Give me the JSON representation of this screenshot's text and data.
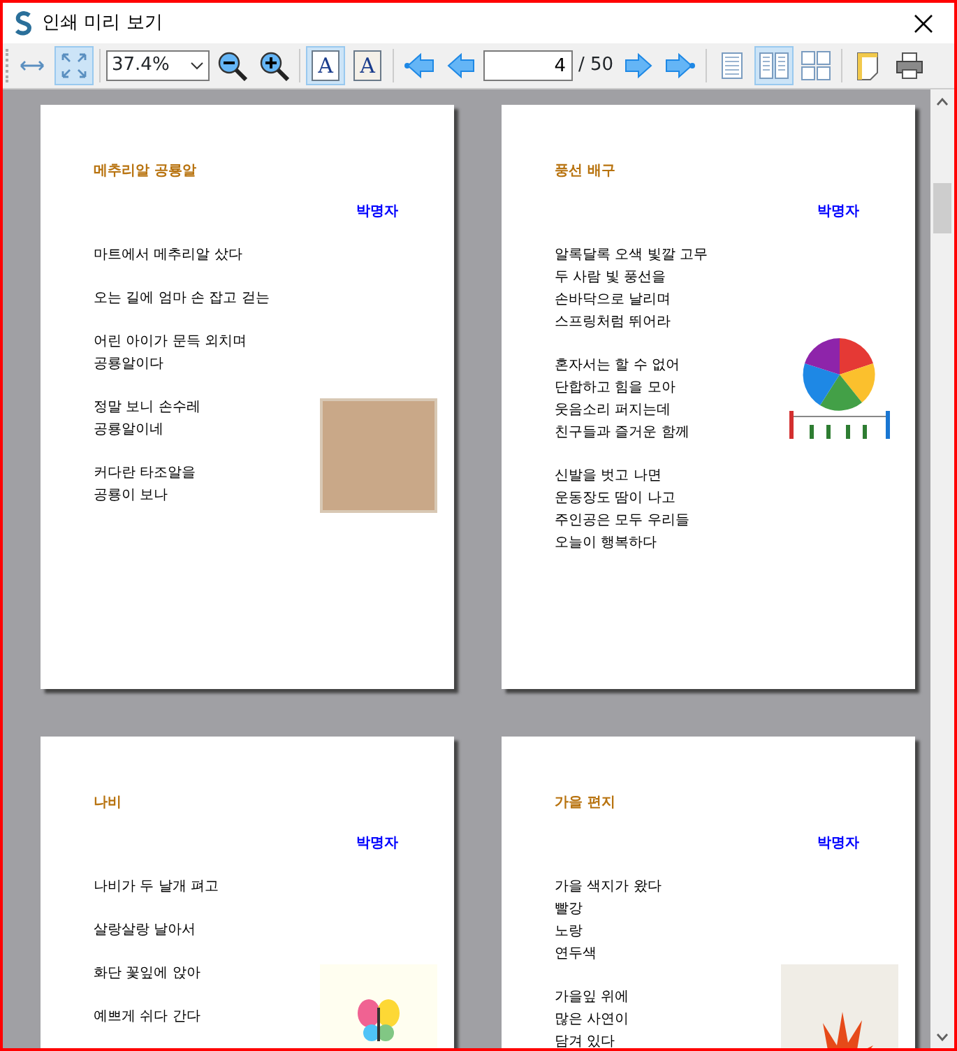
{
  "window": {
    "title": "인쇄 미리 보기"
  },
  "toolbar": [
    {
      "kind": "fit-width",
      "selected": false
    },
    {
      "kind": "fit-page",
      "selected": true
    },
    {
      "kind": "separator"
    },
    {
      "kind": "zoom-select",
      "value": "37.4%"
    },
    {
      "kind": "zoom-out"
    },
    {
      "kind": "zoom-in"
    },
    {
      "kind": "separator"
    },
    {
      "kind": "text-mode",
      "label": "A",
      "selected": true
    },
    {
      "kind": "page-text-mode",
      "label": "A",
      "selected": false
    },
    {
      "kind": "separator"
    },
    {
      "kind": "first-page"
    },
    {
      "kind": "prev-page"
    },
    {
      "kind": "page-input",
      "value": "4"
    },
    {
      "kind": "page-total",
      "text": "/ 50"
    },
    {
      "kind": "next-page"
    },
    {
      "kind": "last-page"
    },
    {
      "kind": "separator"
    },
    {
      "kind": "layout-single",
      "selected": false
    },
    {
      "kind": "layout-double",
      "selected": true
    },
    {
      "kind": "layout-quad",
      "selected": false
    },
    {
      "kind": "separator"
    },
    {
      "kind": "page-setup"
    },
    {
      "kind": "print"
    }
  ],
  "pages": [
    {
      "title": "메추리알 공룡알",
      "author": "박명자",
      "picture": {
        "kind": "photo"
      },
      "stanzas": [
        [
          "마트에서 메추리알 샀다"
        ],
        [
          "오는 길에 엄마 손 잡고 걷는"
        ],
        [
          "어린 아이가 문득 외치며",
          "공룡알이다"
        ],
        [
          "정말 보니 손수레",
          "공룡알이네"
        ],
        [
          "커다란 타조알을",
          "공룡이 보나"
        ]
      ]
    },
    {
      "title": "풍선 배구",
      "author": "박명자",
      "picture": {
        "kind": "ball"
      },
      "stanzas": [
        [
          "알록달록 오색 빛깔 고무",
          "두 사람 빛 풍선을",
          "손바닥으로 날리며",
          "스프링처럼 뛰어라"
        ],
        [
          "혼자서는 할 수 없어",
          "단합하고 힘을 모아",
          "웃음소리 퍼지는데",
          "친구들과 즐거운 함께"
        ],
        [
          "신발을 벗고 나면",
          "운동장도 땀이 나고",
          "주인공은 모두 우리들",
          "오늘이 행복하다"
        ]
      ]
    },
    {
      "title": "나비",
      "author": "박명자",
      "picture": {
        "kind": "butterfly"
      },
      "stanzas": [
        [
          "나비가 두 날개 펴고"
        ],
        [
          "살랑살랑 날아서"
        ],
        [
          "화단 꽃잎에 앉아"
        ],
        [
          "예쁘게 쉬다 간다"
        ]
      ]
    },
    {
      "title": "가을 편지",
      "author": "박명자",
      "picture": {
        "kind": "splash"
      },
      "stanzas": [
        [
          "가을 색지가 왔다",
          "빨강",
          "노랑",
          "연두색"
        ],
        [
          "가을잎 위에",
          "많은 사연이",
          "담겨 있다"
        ]
      ]
    }
  ]
}
